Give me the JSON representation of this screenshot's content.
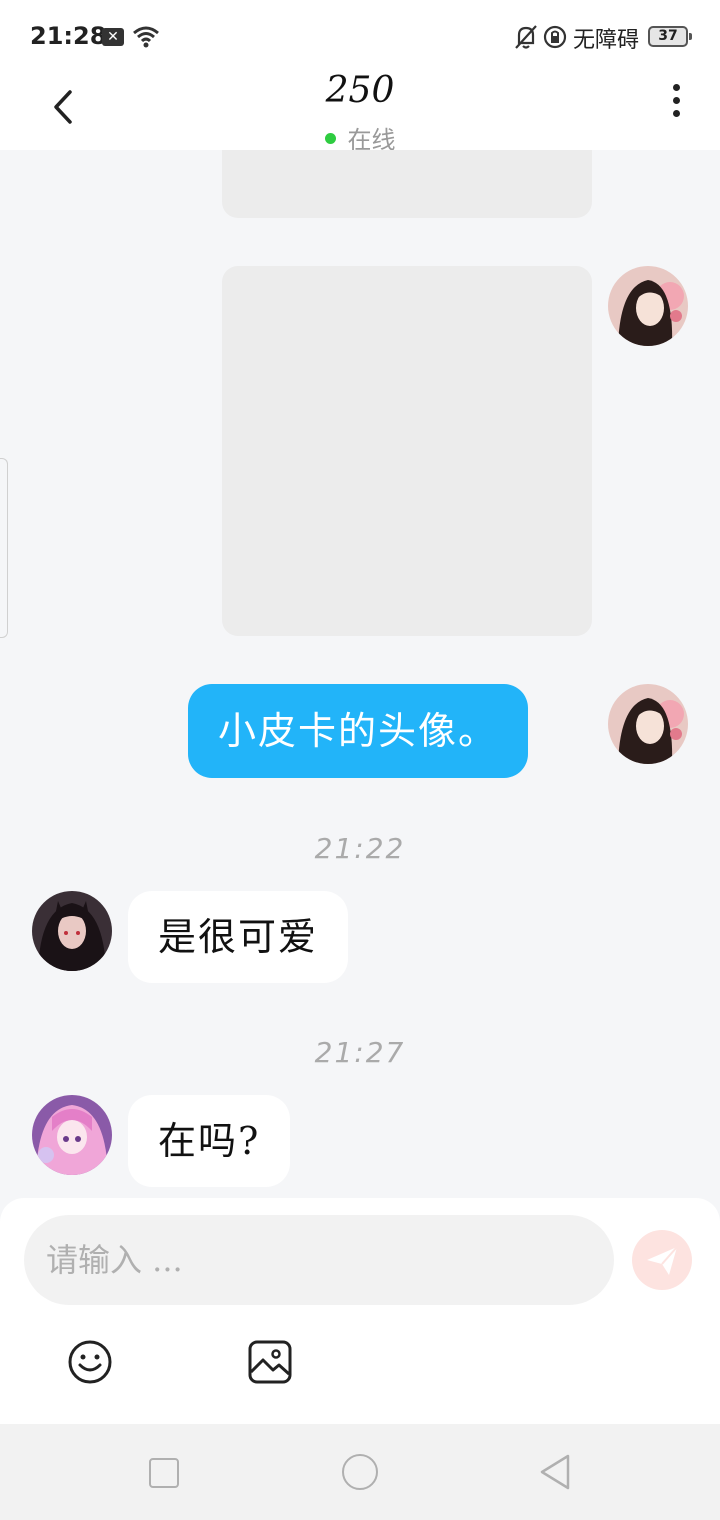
{
  "status_bar": {
    "time": "21:28",
    "notification_icon": "x-box-icon",
    "wifi_icon": "wifi-icon",
    "bell_icon": "bell-off-icon",
    "lock_icon": "rotation-lock-icon",
    "accessibility_label": "无障碍",
    "battery": "37"
  },
  "header": {
    "title": "250",
    "status": "在线",
    "status_color": "#2ecc40"
  },
  "messages": {
    "outgoing_text": "小皮卡的头像。",
    "time_1": "21:22",
    "incoming_1": "是很可爱",
    "time_2": "21:27",
    "incoming_2": "在吗?"
  },
  "input": {
    "placeholder": "请输入 ..."
  },
  "colors": {
    "outgoing_bubble": "#22b4f9",
    "send_button": "#fde3e0",
    "background": "#f5f6f8"
  },
  "icons": {
    "back": "back-arrow-icon",
    "more": "more-vertical-icon",
    "send": "send-icon",
    "emoji": "emoji-icon",
    "image": "image-icon"
  }
}
